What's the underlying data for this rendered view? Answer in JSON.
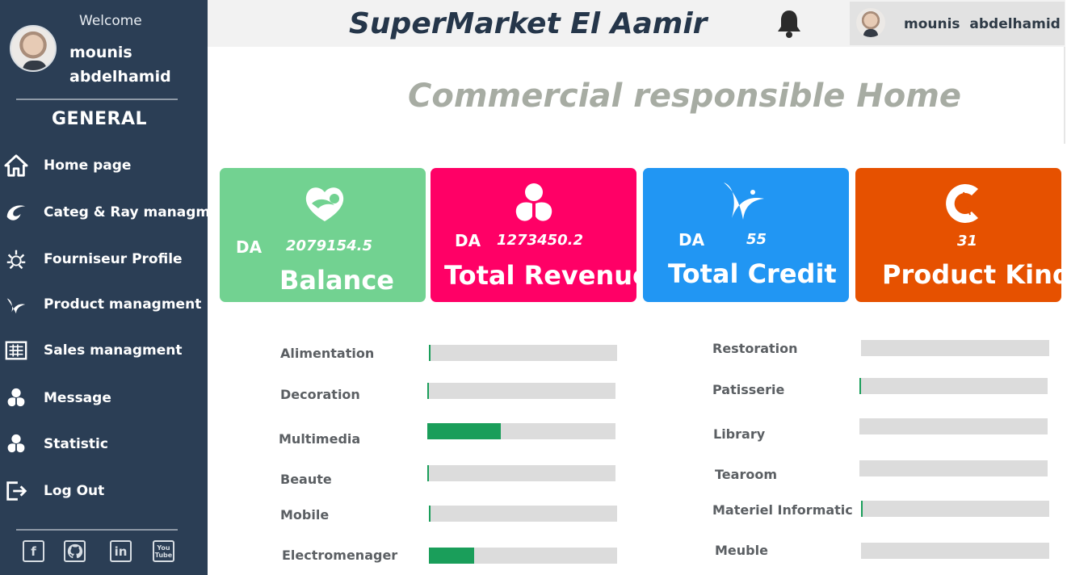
{
  "sidebar": {
    "welcome": "Welcome",
    "user_name": "mounis abdelhamid",
    "section_title": "GENERAL",
    "items": [
      {
        "label": "Home page",
        "icon": "home-icon"
      },
      {
        "label": "Categ & Ray managment",
        "icon": "swirl-logo-icon"
      },
      {
        "label": "Fourniseur Profile",
        "icon": "wreath-icon"
      },
      {
        "label": "Product managment",
        "icon": "wave-icon"
      },
      {
        "label": "Sales managment",
        "icon": "register-icon"
      },
      {
        "label": "Message",
        "icon": "flower-icon"
      },
      {
        "label": "Statistic",
        "icon": "flower-icon"
      },
      {
        "label": "Log Out",
        "icon": "logout-icon"
      }
    ],
    "social": [
      {
        "label": "f",
        "icon": "facebook-icon"
      },
      {
        "label": "gh",
        "icon": "github-icon"
      },
      {
        "label": "in",
        "icon": "linkedin-icon"
      },
      {
        "label": "You Tube",
        "icon": "youtube-icon"
      }
    ]
  },
  "header": {
    "app_title": "SuperMarket El Aamir",
    "bell_icon": "bell-icon",
    "user_name": "mounis  abdelhamid"
  },
  "page_title": "Commercial responsible Home",
  "cards": [
    {
      "currency": "DA",
      "value": "2079154.5",
      "label": "Balance",
      "color": "#72d291",
      "icon": "heart-icon"
    },
    {
      "currency": "DA",
      "value": "1273450.2",
      "label": "Total Revenue",
      "color": "#ff0066",
      "icon": "flower-icon"
    },
    {
      "currency": "DA",
      "value": "55",
      "label": "Total Credit",
      "color": "#2196f3",
      "icon": "wave-icon"
    },
    {
      "currency": "",
      "value": "31",
      "label": "Product Kind",
      "color": "#e65100",
      "icon": "c-logo-icon"
    }
  ],
  "categories_left": [
    {
      "label": "Alimentation",
      "progress": 0.005
    },
    {
      "label": "Decoration",
      "progress": 0.003
    },
    {
      "label": "Multimedia",
      "progress": 0.39
    },
    {
      "label": "Beaute",
      "progress": 0.008
    },
    {
      "label": "Mobile",
      "progress": 0.006
    },
    {
      "label": "Electromenager",
      "progress": 0.24
    }
  ],
  "categories_right": [
    {
      "label": "Restoration",
      "progress": 0.0
    },
    {
      "label": "Patisserie",
      "progress": 0.002
    },
    {
      "label": "Library",
      "progress": 0.0
    },
    {
      "label": "Tearoom",
      "progress": 0.0
    },
    {
      "label": "Materiel Informatic",
      "progress": 0.01
    },
    {
      "label": "Meuble",
      "progress": 0.0
    }
  ]
}
